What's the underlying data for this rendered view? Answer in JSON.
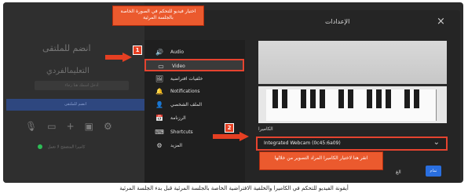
{
  "lobby": {
    "join_text": "انضم للملتقى",
    "display_name": "التعليمالفردي",
    "name_placeholder": "أدخل اسمك هنا رجاء",
    "join_button": "انضم للملتقى",
    "status_text": "كاميرا المتصفح لا تعمل"
  },
  "dialog": {
    "title": "الإعدادات",
    "close_icon": "×",
    "sidebar": [
      {
        "label": "Audio",
        "icon": "speaker-icon",
        "glyph": "🔊"
      },
      {
        "label": "Video",
        "icon": "camera-icon",
        "glyph": "▭"
      },
      {
        "label": "خلفيات افتراضية",
        "icon": "background-icon",
        "glyph": "🖼"
      },
      {
        "label": "Notifications",
        "icon": "bell-icon",
        "glyph": "🔔"
      },
      {
        "label": "الملف الشخصي",
        "icon": "person-icon",
        "glyph": "👤"
      },
      {
        "label": "الرزنامة",
        "icon": "calendar-icon",
        "glyph": "📅"
      },
      {
        "label": "Shortcuts",
        "icon": "shortcut-icon",
        "glyph": "⌨"
      },
      {
        "label": "المزيد",
        "icon": "gear-icon",
        "glyph": "⚙"
      }
    ],
    "camera_label": "الكاميرا",
    "camera_value": "Integrated Webcam (0c45:6a09)",
    "chevron": "⌄",
    "cancel": "الغ",
    "save": "تمام"
  },
  "callouts": {
    "first": "اختيار فيديو للتحكم في الصورة الخاصة بالجلسة المرئية",
    "second": "انقر هنا لاختيار الكاميرا المراد التصوير من خلالها",
    "marker_1": "1",
    "marker_2": "2"
  },
  "caption": "أيقونة الفيديو للتحكم في الكاميرا والخلفية الافتراضية الخاصة بالجلسة المرئية قبل بدء الجلسة المرئية"
}
